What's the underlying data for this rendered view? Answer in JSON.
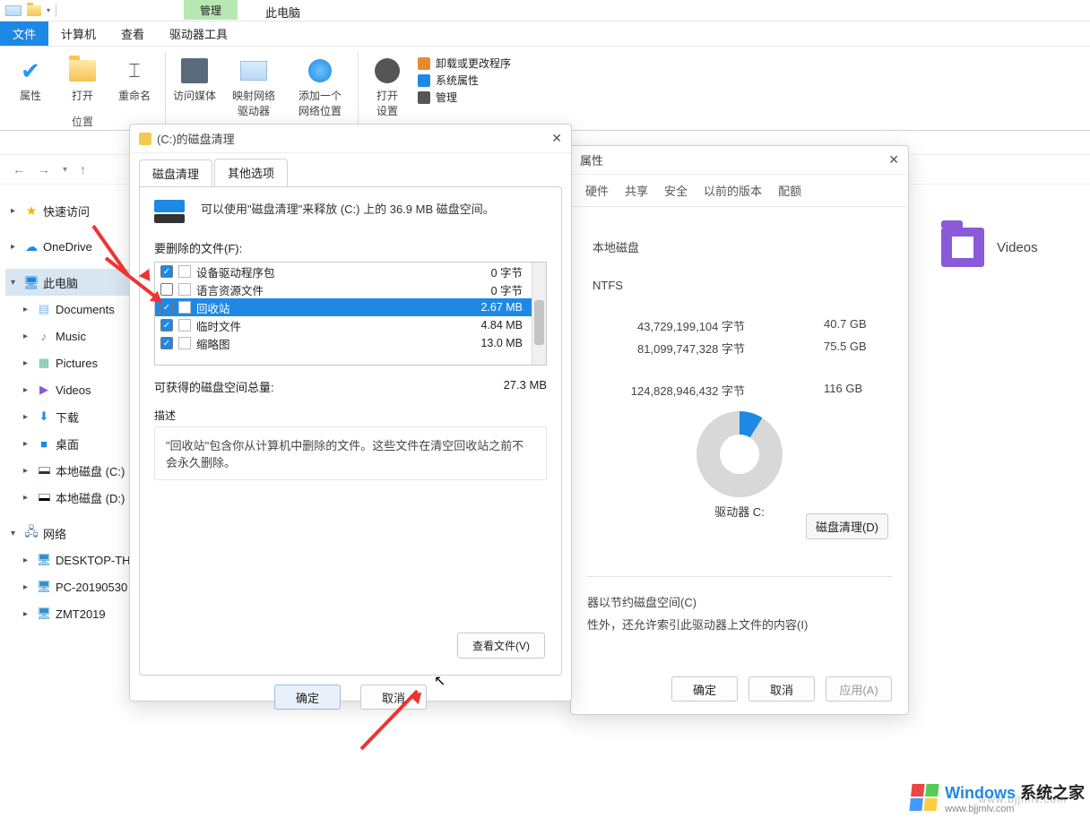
{
  "top": {
    "manage": "管理",
    "thisPC": "此电脑"
  },
  "menu": {
    "file": "文件",
    "computer": "计算机",
    "view": "查看",
    "driveTools": "驱动器工具"
  },
  "ribbon": {
    "props": "属性",
    "open": "打开",
    "rename": "重命名",
    "access": "访问媒体",
    "mapDrive": "映射网络\n驱动器",
    "addNet": "添加一个\n网络位置",
    "openSettings": "打开\n设置",
    "uninstall": "卸载或更改程序",
    "sysProps": "系统属性",
    "admin": "管理",
    "group1": "位置"
  },
  "tree": {
    "quick": "快速访问",
    "onedrive": "OneDrive",
    "thispc": "此电脑",
    "docs": "Documents",
    "music": "Music",
    "pictures": "Pictures",
    "videos": "Videos",
    "downloads": "下载",
    "desktop": "桌面",
    "diskC": "本地磁盘 (C:)",
    "diskD": "本地磁盘 (D:)",
    "network": "网络",
    "n1": "DESKTOP-TH",
    "n2": "PC-20190530",
    "n3": "ZMT2019"
  },
  "content": {
    "videos": "Videos"
  },
  "props": {
    "title": "属性",
    "tabs": {
      "hardware": "硬件",
      "share": "共享",
      "security": "安全",
      "prev": "以前的版本",
      "quota": "配额"
    },
    "type": "本地磁盘",
    "fs": "NTFS",
    "usedBytes": "43,729,199,104 字节",
    "usedGB": "40.7 GB",
    "freeBytes": "81,099,747,328 字节",
    "freeGB": "75.5 GB",
    "totalBytes": "124,828,946,432 字节",
    "totalGB": "116 GB",
    "driveLabel": "驱动器 C:",
    "diskCleanup": "磁盘清理(D)",
    "compress": "器以节约磁盘空间(C)",
    "allowIndex": "性外，还允许索引此驱动器上文件的内容(I)",
    "ok": "确定",
    "cancel": "取消",
    "apply": "应用(A)"
  },
  "clean": {
    "title": "(C:)的磁盘清理",
    "tab1": "磁盘清理",
    "tab2": "其他选项",
    "summary": "可以使用\"磁盘清理\"来释放 (C:) 上的 36.9 MB 磁盘空间。",
    "filesLabel": "要删除的文件(F):",
    "rows": [
      {
        "checked": true,
        "name": "设备驱动程序包",
        "size": "0 字节"
      },
      {
        "checked": false,
        "name": "语言资源文件",
        "size": "0 字节"
      },
      {
        "checked": true,
        "name": "回收站",
        "size": "2.67 MB",
        "selected": true
      },
      {
        "checked": true,
        "name": "临时文件",
        "size": "4.84 MB"
      },
      {
        "checked": true,
        "name": "缩略图",
        "size": "13.0 MB"
      }
    ],
    "totalLabel": "可获得的磁盘空间总量:",
    "totalSize": "27.3 MB",
    "descHead": "描述",
    "desc": "\"回收站\"包含你从计算机中删除的文件。这些文件在清空回收站之前不会永久删除。",
    "viewFiles": "查看文件(V)",
    "ok": "确定",
    "cancel": "取消"
  },
  "site": {
    "win": "Windows",
    "name": "系统之家",
    "url": "www.bjjmlv.com"
  }
}
